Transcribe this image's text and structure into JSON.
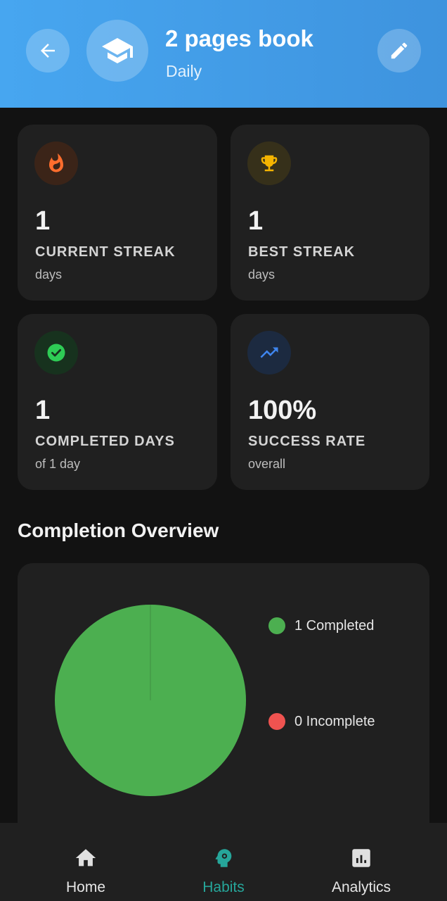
{
  "header": {
    "title": "2 pages book",
    "frequency": "Daily",
    "colors": {
      "gradient_start": "#47a6f0",
      "gradient_end": "#3e93de"
    },
    "icons": {
      "back": "arrow-left-icon",
      "habit": "graduation-cap-icon",
      "edit": "pencil-icon"
    }
  },
  "stats": [
    {
      "value": "1",
      "label": "CURRENT STREAK",
      "sub": "days",
      "icon": "fire-icon",
      "color": "#ff6d2d"
    },
    {
      "value": "1",
      "label": "BEST STREAK",
      "sub": "days",
      "icon": "trophy-icon",
      "color": "#f5b400"
    },
    {
      "value": "1",
      "label": "COMPLETED DAYS",
      "sub": "of 1 day",
      "icon": "check-circle-icon",
      "color": "#2ecc55"
    },
    {
      "value": "100%",
      "label": "SUCCESS RATE",
      "sub": "overall",
      "icon": "trending-up-icon",
      "color": "#3f86f0"
    }
  ],
  "overview": {
    "title": "Completion Overview",
    "legend": [
      {
        "text": "1 Completed",
        "color": "#4caf50"
      },
      {
        "text": "0 Incomplete",
        "color": "#ef5350"
      }
    ]
  },
  "chart_data": {
    "type": "pie",
    "categories": [
      "Completed",
      "Incomplete"
    ],
    "values": [
      1,
      0
    ],
    "colors": [
      "#4caf50",
      "#ef5350"
    ]
  },
  "nav": {
    "active": "Habits",
    "active_color": "#26a69a",
    "items": [
      {
        "label": "Home",
        "icon": "home-icon"
      },
      {
        "label": "Habits",
        "icon": "brain-gear-icon"
      },
      {
        "label": "Analytics",
        "icon": "bar-chart-icon"
      }
    ]
  }
}
